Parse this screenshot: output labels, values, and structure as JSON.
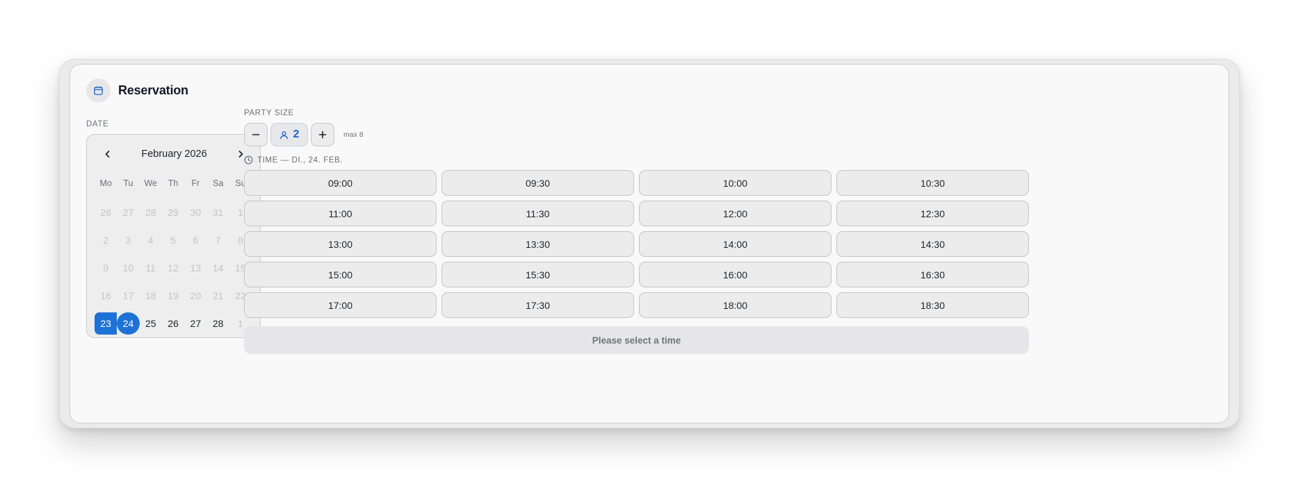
{
  "header": {
    "title": "Reservation",
    "icon": "calendar-icon"
  },
  "date_section": {
    "label": "DATE",
    "month_label": "February 2026",
    "weekdays": [
      "Mo",
      "Tu",
      "We",
      "Th",
      "Fr",
      "Sa",
      "Su"
    ],
    "days": [
      {
        "d": "26",
        "state": "muted"
      },
      {
        "d": "27",
        "state": "muted"
      },
      {
        "d": "28",
        "state": "muted"
      },
      {
        "d": "29",
        "state": "muted"
      },
      {
        "d": "30",
        "state": "muted"
      },
      {
        "d": "31",
        "state": "muted"
      },
      {
        "d": "1",
        "state": "muted"
      },
      {
        "d": "2",
        "state": "muted"
      },
      {
        "d": "3",
        "state": "muted"
      },
      {
        "d": "4",
        "state": "muted"
      },
      {
        "d": "5",
        "state": "muted"
      },
      {
        "d": "6",
        "state": "muted"
      },
      {
        "d": "7",
        "state": "muted"
      },
      {
        "d": "8",
        "state": "muted"
      },
      {
        "d": "9",
        "state": "muted"
      },
      {
        "d": "10",
        "state": "muted"
      },
      {
        "d": "11",
        "state": "muted"
      },
      {
        "d": "12",
        "state": "muted"
      },
      {
        "d": "13",
        "state": "muted"
      },
      {
        "d": "14",
        "state": "muted"
      },
      {
        "d": "15",
        "state": "muted"
      },
      {
        "d": "16",
        "state": "muted"
      },
      {
        "d": "17",
        "state": "muted"
      },
      {
        "d": "18",
        "state": "muted"
      },
      {
        "d": "19",
        "state": "muted"
      },
      {
        "d": "20",
        "state": "muted"
      },
      {
        "d": "21",
        "state": "muted"
      },
      {
        "d": "22",
        "state": "muted"
      },
      {
        "d": "23",
        "state": "range-start"
      },
      {
        "d": "24",
        "state": "selected"
      },
      {
        "d": "25",
        "state": "active"
      },
      {
        "d": "26",
        "state": "active"
      },
      {
        "d": "27",
        "state": "active"
      },
      {
        "d": "28",
        "state": "active"
      },
      {
        "d": "1",
        "state": "muted"
      }
    ]
  },
  "party_section": {
    "label": "PARTY SIZE",
    "value": "2",
    "max_label": "max 8",
    "decrement_symbol": "−",
    "increment_symbol": "+"
  },
  "time_section": {
    "label": "TIME — DI., 24. FEB.",
    "slots": [
      "09:00",
      "09:30",
      "10:00",
      "10:30",
      "11:00",
      "11:30",
      "12:00",
      "12:30",
      "13:00",
      "13:30",
      "14:00",
      "14:30",
      "15:00",
      "15:30",
      "16:00",
      "16:30",
      "17:00",
      "17:30",
      "18:00",
      "18:30"
    ]
  },
  "cta": {
    "label": "Please select a time"
  },
  "colors": {
    "accent": "#1e72d6",
    "accent_text": "#1e64c4",
    "muted_day": "#c3c4c7"
  }
}
